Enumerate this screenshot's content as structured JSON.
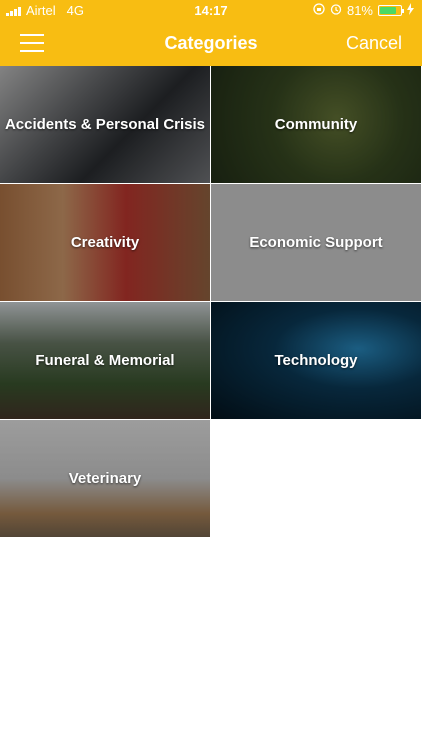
{
  "status_bar": {
    "carrier": "Airtel",
    "network": "4G",
    "time": "14:17",
    "battery_percent": "81%",
    "battery_level": 0.81
  },
  "nav": {
    "title": "Categories",
    "cancel_label": "Cancel"
  },
  "categories": [
    {
      "label": "Accidents & Personal Crisis"
    },
    {
      "label": "Community"
    },
    {
      "label": "Creativity"
    },
    {
      "label": "Economic Support"
    },
    {
      "label": "Funeral & Memorial"
    },
    {
      "label": "Technology"
    },
    {
      "label": "Veterinary"
    }
  ],
  "colors": {
    "brand": "#f8bd12",
    "text_on_brand": "#ffffff",
    "battery": "#4cd964"
  },
  "icons": {
    "menu": "hamburger-menu-icon",
    "alarm": "alarm-clock-icon",
    "lock": "orientation-lock-icon",
    "charging": "charging-bolt-icon"
  }
}
